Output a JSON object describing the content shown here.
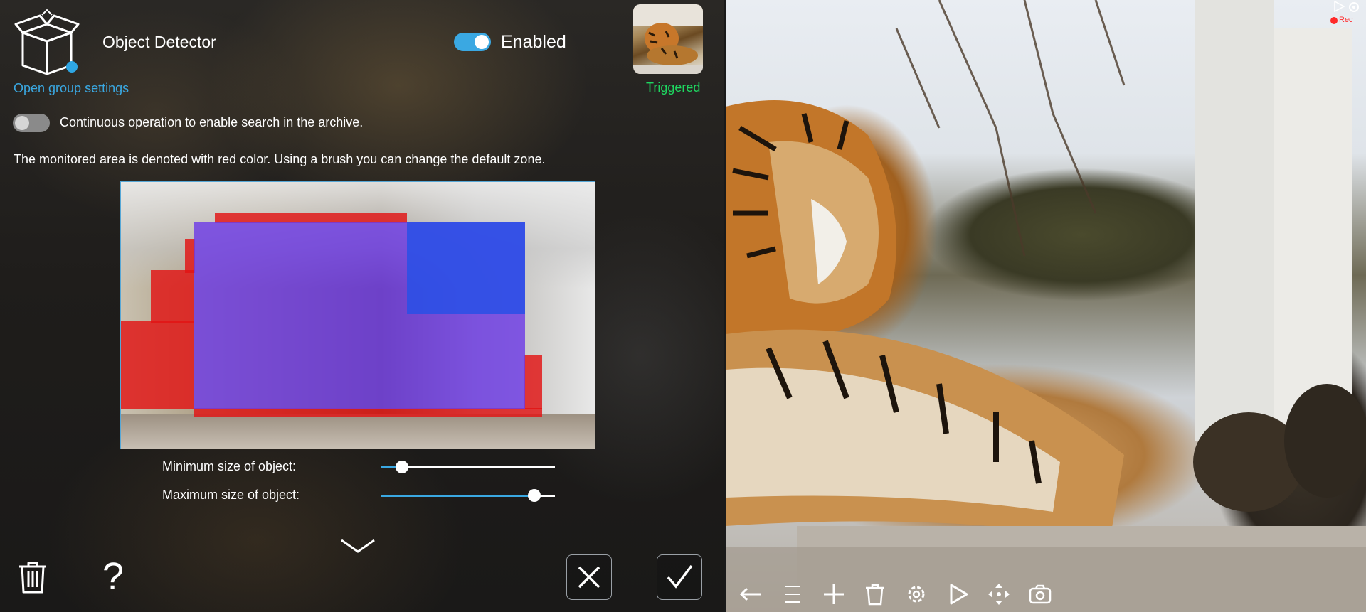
{
  "panel": {
    "title": "Object Detector",
    "group_link": "Open group settings",
    "enabled": {
      "label": "Enabled",
      "state": true
    },
    "status": {
      "label": "Triggered",
      "color": "#1ed760"
    },
    "continuous": {
      "label": "Continuous operation to enable search in the archive.",
      "state": false
    },
    "info_text": "The monitored area is denoted with red color. Using a brush you can change the default zone.",
    "sliders": [
      {
        "label": "Minimum size of object:",
        "value": 0.09
      },
      {
        "label": "Maximum size of object:",
        "value": 0.91
      }
    ],
    "accent_color": "#3aa8e2",
    "zone_color": "#e21414"
  },
  "video": {
    "rec_label": "Rec"
  },
  "icons": {
    "group": "box-icon",
    "delete": "trash-icon",
    "help": "question-icon",
    "cancel": "close-icon",
    "confirm": "check-icon",
    "expand": "chevron-down-icon",
    "toolbar": [
      "arrow-left-icon",
      "menu-icon",
      "plus-icon",
      "trash-icon",
      "gear-icon",
      "play-icon",
      "move-icon",
      "camera-icon"
    ]
  }
}
